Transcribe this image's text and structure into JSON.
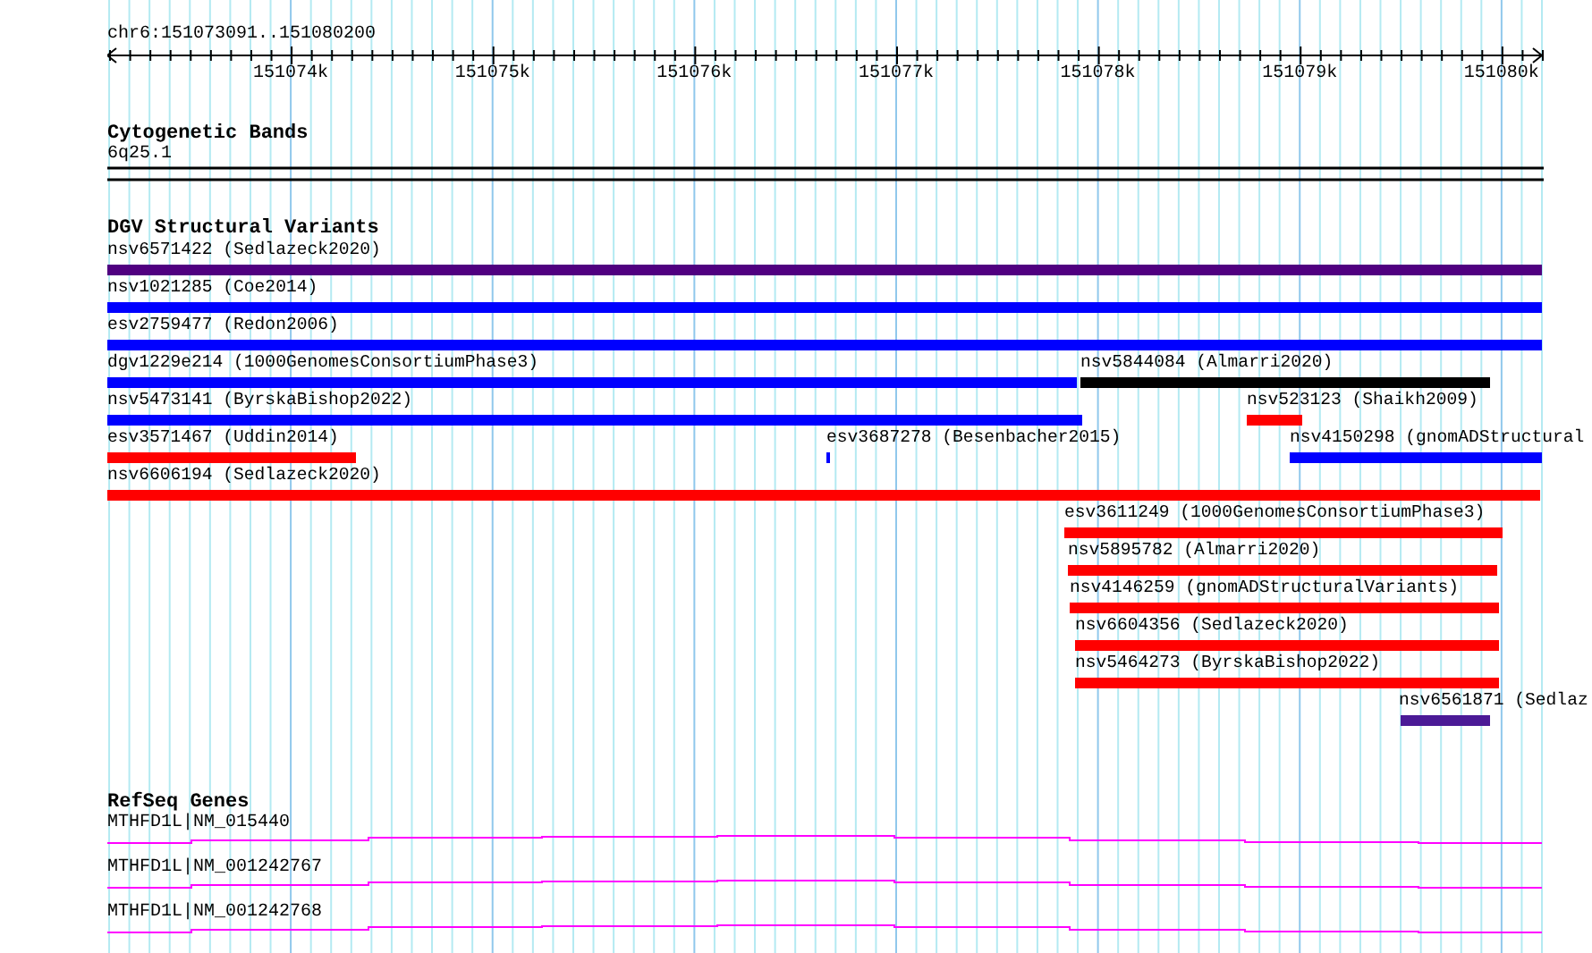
{
  "ruler": {
    "location": "chr6:151073091..151080200",
    "ticks": [
      "151074k",
      "151075k",
      "151076k",
      "151077k",
      "151078k",
      "151079k",
      "151080k"
    ]
  },
  "tracks": [
    {
      "kind": "bands",
      "title": "Cytogenetic Bands",
      "features": [
        {
          "label": "6q25.1"
        }
      ]
    },
    {
      "kind": "variants",
      "title": "DGV Structural Variants",
      "features": [
        {
          "label": "nsv6571422 (Sedlazeck2020)",
          "color": "#500080"
        },
        {
          "label": "nsv1021285 (Coe2014)",
          "color": "#0000ff"
        },
        {
          "label": "esv2759477 (Redon2006)",
          "color": "#0000ff"
        },
        {
          "label": "dgv1229e214 (1000GenomesConsortiumPhase3)",
          "color": "#0000ff"
        },
        {
          "label": "nsv5844084 (Almarri2020)",
          "color": "#000000"
        },
        {
          "label": "nsv5473141 (ByrskaBishop2022)",
          "color": "#0000ff"
        },
        {
          "label": "nsv523123 (Shaikh2009)",
          "color": "#ff0000"
        },
        {
          "label": "esv3571467 (Uddin2014)",
          "color": "#ff0000"
        },
        {
          "label": "esv3687278 (Besenbacher2015)",
          "color": "#0000ff"
        },
        {
          "label": "nsv4150298 (gnomADStructural",
          "color": "#0000ff"
        },
        {
          "label": "nsv6606194 (Sedlazeck2020)",
          "color": "#ff0000"
        },
        {
          "label": "esv3611249 (1000GenomesConsortiumPhase3)",
          "color": "#ff0000"
        },
        {
          "label": "nsv5895782 (Almarri2020)",
          "color": "#ff0000"
        },
        {
          "label": "nsv4146259 (gnomADStructuralVariants)",
          "color": "#ff0000"
        },
        {
          "label": "nsv6604356 (Sedlazeck2020)",
          "color": "#ff0000"
        },
        {
          "label": "nsv5464273 (ByrskaBishop2022)",
          "color": "#ff0000"
        },
        {
          "label": "nsv6561871 (Sedlaz",
          "color": "#4b1a96"
        }
      ]
    },
    {
      "kind": "genes",
      "title": "RefSeq Genes",
      "features": [
        {
          "label": "MTHFD1L|NM_015440"
        },
        {
          "label": "MTHFD1L|NM_001242767"
        },
        {
          "label": "MTHFD1L|NM_001242768"
        }
      ]
    }
  ]
}
